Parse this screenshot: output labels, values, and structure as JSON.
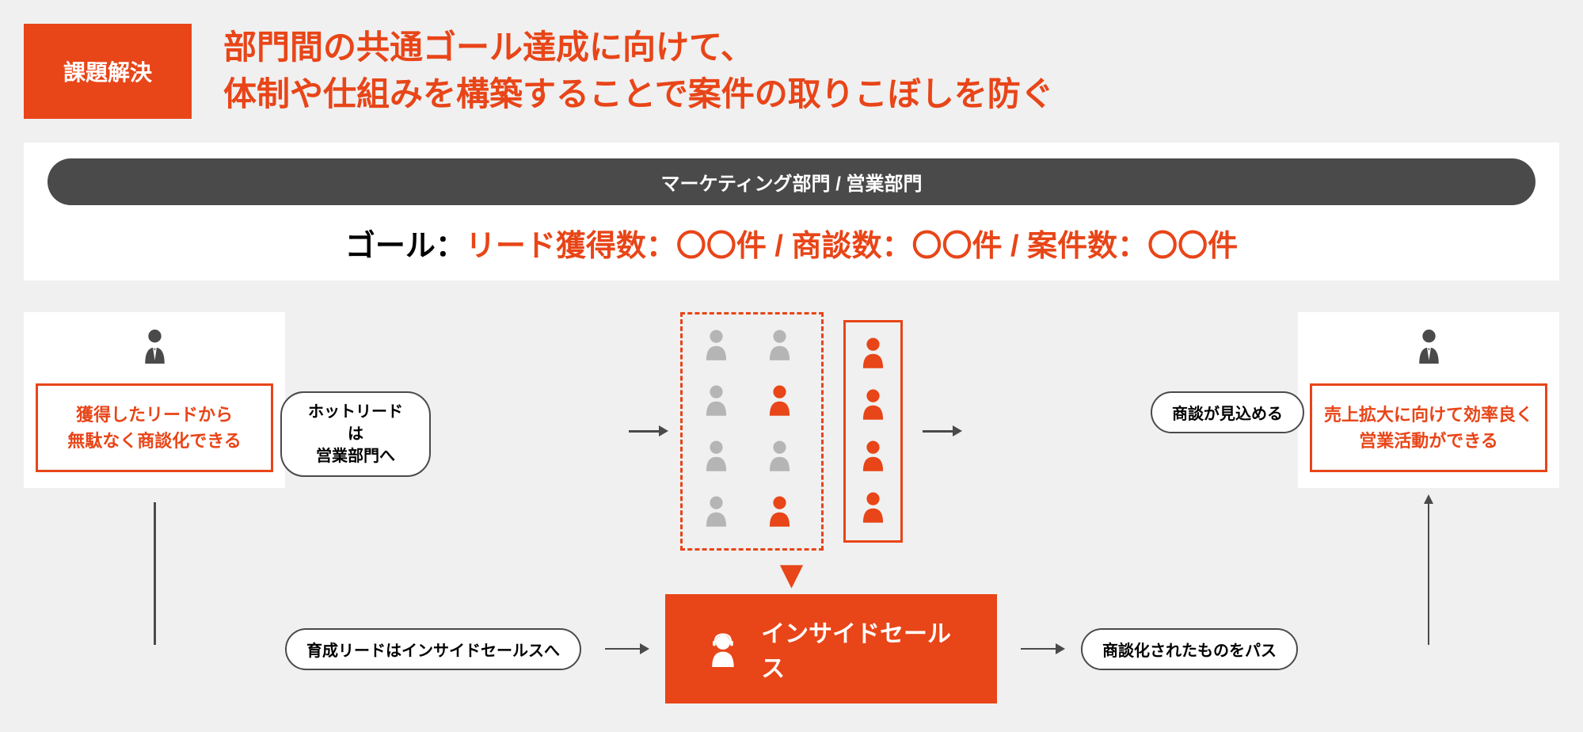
{
  "header": {
    "badge": "課題解決",
    "title_line1": "部門間の共通ゴール達成に向けて、",
    "title_line2": "体制や仕組みを構築することで案件の取りこぼしを防ぐ"
  },
  "department_bar": "マーケティング部門 / 営業部門",
  "goal": {
    "prefix": "ゴール：",
    "value": "リード獲得数：〇〇件 / 商談数：〇〇件 / 案件数：〇〇件"
  },
  "persona_left": {
    "line1": "獲得したリードから",
    "line2": "無駄なく商談化できる"
  },
  "persona_right": {
    "line1": "売上拡大に向けて効率良く",
    "line2": "営業活動ができる"
  },
  "pill_hot_lead": "ホットリードは\n営業部門へ",
  "pill_prospect": "商談が見込める",
  "pill_nurture": "育成リードはインサイドセールスへ",
  "pill_pass": "商談化されたものをパス",
  "inside_sales": "インサイドセールス",
  "lead_colors": [
    "#b5b5b5",
    "#b5b5b5",
    "#b5b5b5",
    "#e84518",
    "#b5b5b5",
    "#b5b5b5",
    "#b5b5b5",
    "#e84518"
  ],
  "hot_colors": [
    "#e84518",
    "#e84518",
    "#e84518",
    "#e84518"
  ]
}
